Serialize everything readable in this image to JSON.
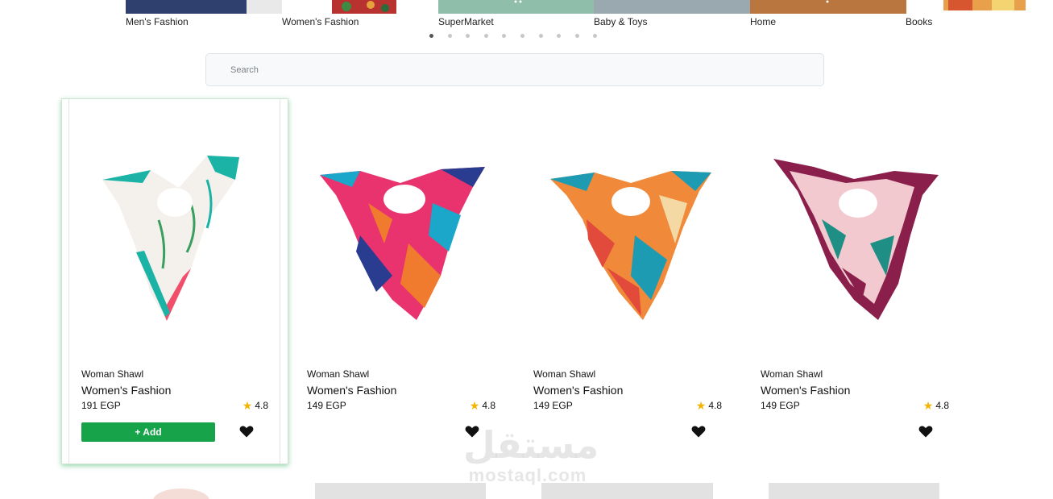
{
  "categories": [
    {
      "label": "Men's Fashion",
      "color": "#2f3f6e"
    },
    {
      "label": "Women's Fashion",
      "color": "#d96d3a"
    },
    {
      "label": "SuperMarket",
      "color": "#8fbfaa"
    },
    {
      "label": "Baby & Toys",
      "color": "#9aa9b0"
    },
    {
      "label": "Home",
      "color": "#b9773f"
    },
    {
      "label": "Books",
      "color": "#e8a04a"
    }
  ],
  "slider": {
    "dot_count": 10,
    "active_dot": 0
  },
  "search": {
    "placeholder": "Search"
  },
  "products": [
    {
      "name": "Woman Shawl",
      "category": "Women's Fashion",
      "price": "191 EGP",
      "rating": "4.8",
      "add_label": "+ Add",
      "palette": [
        "#1bb3a6",
        "#f04e6a",
        "#f4f0ec",
        "#3a9e5f"
      ]
    },
    {
      "name": "Woman Shawl",
      "category": "Women's Fashion",
      "price": "149 EGP",
      "rating": "4.8",
      "palette": [
        "#e8336f",
        "#2a3c8f",
        "#f07b2e",
        "#1aa7c9"
      ]
    },
    {
      "name": "Woman Shawl",
      "category": "Women's Fashion",
      "price": "149 EGP",
      "rating": "4.8",
      "palette": [
        "#f08a3a",
        "#1c9bb2",
        "#e24a3b",
        "#f4d9a4"
      ]
    },
    {
      "name": "Woman Shawl",
      "category": "Women's Fashion",
      "price": "149 EGP",
      "rating": "4.8",
      "palette": [
        "#8a1f4c",
        "#f2c9cf",
        "#1f8f86",
        "#f7e7e9"
      ]
    }
  ],
  "watermark": {
    "arabic": "مستقل",
    "latin": "mostaql.com"
  }
}
